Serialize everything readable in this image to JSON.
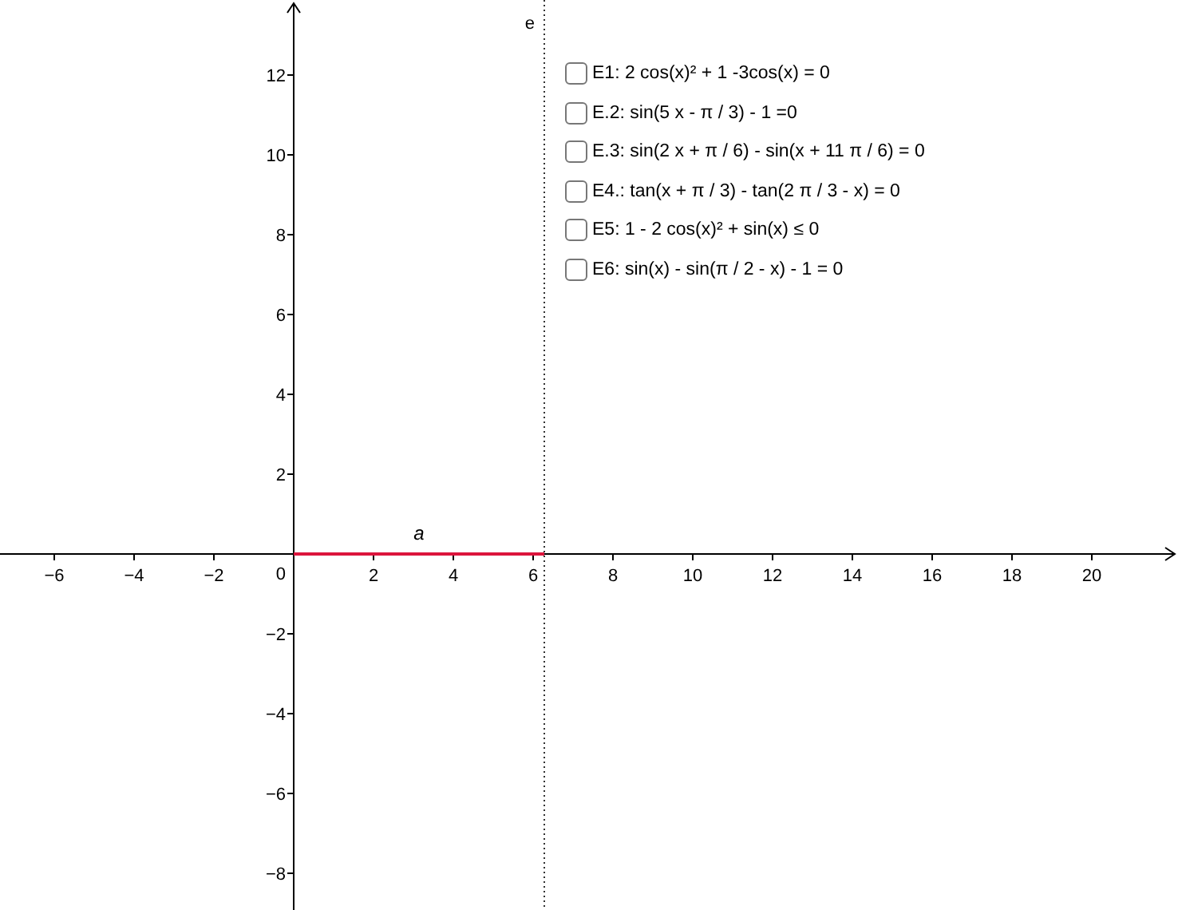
{
  "graphics_view": {
    "origin_label": "0",
    "chart_data": {
      "type": "line",
      "xlim": [
        -7.36,
        22.16
      ],
      "ylim": [
        -8.92,
        13.88
      ],
      "xticks": [
        {
          "value": -6,
          "label": "−6"
        },
        {
          "value": -4,
          "label": "−4"
        },
        {
          "value": -2,
          "label": "−2"
        },
        {
          "value": 2,
          "label": "2"
        },
        {
          "value": 4,
          "label": "4"
        },
        {
          "value": 6,
          "label": "6"
        },
        {
          "value": 8,
          "label": "8"
        },
        {
          "value": 10,
          "label": "10"
        },
        {
          "value": 12,
          "label": "12"
        },
        {
          "value": 14,
          "label": "14"
        },
        {
          "value": 16,
          "label": "16"
        },
        {
          "value": 18,
          "label": "18"
        },
        {
          "value": 20,
          "label": "20"
        }
      ],
      "yticks": [
        {
          "value": -8,
          "label": "−8"
        },
        {
          "value": -6,
          "label": "−6"
        },
        {
          "value": -4,
          "label": "−4"
        },
        {
          "value": -2,
          "label": "−2"
        },
        {
          "value": 2,
          "label": "2"
        },
        {
          "value": 4,
          "label": "4"
        },
        {
          "value": 6,
          "label": "6"
        },
        {
          "value": 8,
          "label": "8"
        },
        {
          "value": 10,
          "label": "10"
        },
        {
          "value": 12,
          "label": "12"
        }
      ],
      "x": [
        0,
        6.28
      ],
      "series": [
        {
          "name": "a",
          "color": "#dc143c",
          "values": [
            0,
            0
          ]
        }
      ],
      "ref_lines": [
        {
          "axis": "x",
          "value": 6.28,
          "label": "e"
        }
      ]
    }
  },
  "checkboxes": [
    {
      "label": "E1: 2 cos(x)² + 1 -3cos(x) = 0",
      "checked": false
    },
    {
      "label": "E.2: sin(5 x - π / 3) - 1 =0",
      "checked": false
    },
    {
      "label": "E.3: sin(2 x + π / 6) - sin(x + 11 π / 6) = 0",
      "checked": false
    },
    {
      "label": "E4.: tan(x + π / 3) - tan(2 π / 3 - x) = 0",
      "checked": false
    },
    {
      "label": "E5: 1 - 2 cos(x)² + sin(x) ≤ 0",
      "checked": false
    },
    {
      "label": "E6: sin(x) - sin(π / 2 - x) - 1 = 0",
      "checked": false
    }
  ]
}
